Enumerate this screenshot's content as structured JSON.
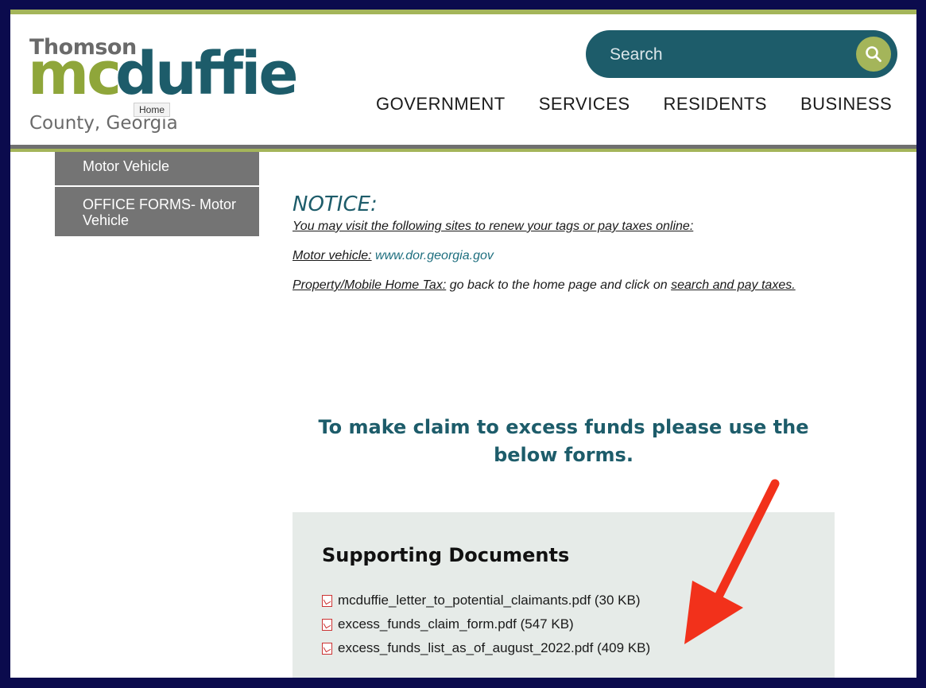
{
  "logo": {
    "line1": "Thomson",
    "mc": "mc",
    "duffie": "duffie",
    "line3": "County, Georgia",
    "home_tooltip": "Home",
    "colors": {
      "green": "#8fa63a",
      "teal": "#1d5c6a",
      "gray": "#6a6a6a"
    }
  },
  "search": {
    "placeholder": "Search",
    "icon": "search-icon"
  },
  "nav": [
    "GOVERNMENT",
    "SERVICES",
    "RESIDENTS",
    "BUSINESS"
  ],
  "sidebar": [
    "Motor Vehicle",
    "OFFICE FORMS- Motor Vehicle"
  ],
  "notice": {
    "title": "NOTICE:",
    "line1": "You may visit the following sites to renew your tags or pay taxes online:",
    "mv_label": "Motor vehicle:",
    "mv_link": "www.dor.georgia.gov",
    "prop_label": "Property/Mobile Home Tax:",
    "prop_text": " go back to the home page and click on ",
    "prop_link": "search and pay taxes."
  },
  "claim_heading": "To make claim to excess funds please use the below forms.",
  "documents": {
    "title": "Supporting Documents",
    "items": [
      "mcduffie_letter_to_potential_claimants.pdf (30 KB)",
      "excess_funds_claim_form.pdf (547 KB)",
      "excess_funds_list_as_of_august_2022.pdf (409 KB)"
    ]
  },
  "theme": {
    "accent_green": "#a4b55a",
    "teal": "#1d5c6a",
    "border": "#0b0b4d",
    "annotation_red": "#f2311b"
  }
}
